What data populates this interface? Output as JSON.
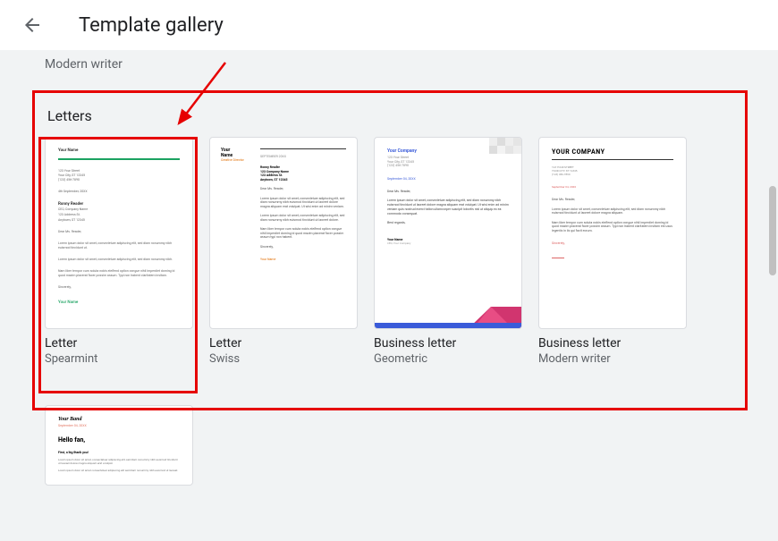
{
  "header": {
    "title": "Template gallery"
  },
  "prev_category_subtitle": "Modern writer",
  "section": {
    "title": "Letters"
  },
  "templates": [
    {
      "title": "Letter",
      "subtitle": "Spearmint",
      "preview": {
        "name": "Your Name",
        "date": "4th September, 20XX",
        "recipient_name": "Ronny Reader",
        "signoff": "Sincerely,",
        "signature": "Your Name"
      }
    },
    {
      "title": "Letter",
      "subtitle": "Swiss",
      "preview": {
        "name_line1": "Your",
        "name_line2": "Name",
        "role": "Creative Director",
        "date": "SEPTEMBER 20XX",
        "recipient_name": "Ronny Reader",
        "greeting": "Dear Ms. Reader,",
        "signoff": "Sincerely,",
        "signature": "Your Name"
      }
    },
    {
      "title": "Business letter",
      "subtitle": "Geometric",
      "preview": {
        "company": "Your Company",
        "addr1": "123 Your Street",
        "date": "September 04, 20XX",
        "greeting": "Dear Ms. Reader,",
        "signoff": "Best regards,",
        "name": "Your Name",
        "title_sub": "CEO, Your Company"
      }
    },
    {
      "title": "Business letter",
      "subtitle": "Modern writer",
      "preview": {
        "company": "YOUR COMPANY",
        "date": "September 04, 20XX",
        "greeting": "Dear Ms. Reader,",
        "signoff": "Sincerely,"
      }
    }
  ],
  "next_template": {
    "preview": {
      "band": "Your Band",
      "date": "September 04, 20XX",
      "hello": "Hello fan,",
      "first": "First, a big thank you!"
    }
  }
}
